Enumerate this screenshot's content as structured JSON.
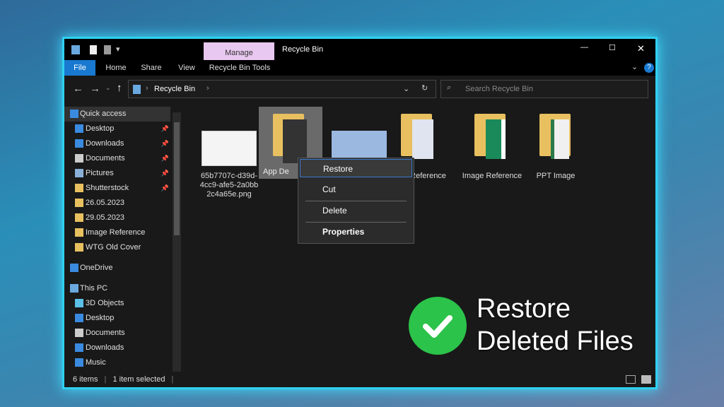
{
  "window": {
    "title": "Recycle Bin",
    "manage_tab": "Manage",
    "minimize": "—",
    "maximize": "☐",
    "close": "✕"
  },
  "ribbon": {
    "tabs": [
      "File",
      "Home",
      "Share",
      "View",
      "Recycle Bin Tools"
    ],
    "help": "?"
  },
  "address": {
    "path": "Recycle Bin",
    "search_placeholder": "Search Recycle Bin"
  },
  "sidebar": {
    "items": [
      {
        "label": "Quick access",
        "icon": "star-icon",
        "pinned": false
      },
      {
        "label": "Desktop",
        "icon": "desktop-icon",
        "pinned": true
      },
      {
        "label": "Downloads",
        "icon": "download-icon",
        "pinned": true
      },
      {
        "label": "Documents",
        "icon": "document-icon",
        "pinned": true
      },
      {
        "label": "Pictures",
        "icon": "pictures-icon",
        "pinned": true
      },
      {
        "label": "Shutterstock",
        "icon": "folder-icon",
        "pinned": true
      },
      {
        "label": "26.05.2023",
        "icon": "folder-icon",
        "pinned": false
      },
      {
        "label": "29.05.2023",
        "icon": "folder-icon",
        "pinned": false
      },
      {
        "label": "Image Reference",
        "icon": "folder-icon",
        "pinned": false
      },
      {
        "label": "WTG Old Cover",
        "icon": "folder-icon",
        "pinned": false
      },
      {
        "label": "OneDrive",
        "icon": "cloud-icon",
        "pinned": false
      },
      {
        "label": "This PC",
        "icon": "computer-icon",
        "pinned": false
      },
      {
        "label": "3D Objects",
        "icon": "cube-icon",
        "pinned": false
      },
      {
        "label": "Desktop",
        "icon": "desktop-icon",
        "pinned": false
      },
      {
        "label": "Documents",
        "icon": "document-icon",
        "pinned": false
      },
      {
        "label": "Downloads",
        "icon": "download-icon",
        "pinned": false
      },
      {
        "label": "Music",
        "icon": "music-icon",
        "pinned": false
      }
    ]
  },
  "files": [
    {
      "name": "65b7707c-d39d-4cc9-afe5-2a0bb2c4a65e.png"
    },
    {
      "name": "App De"
    },
    {
      "name": ""
    },
    {
      "name": "e Reference"
    },
    {
      "name": "Image Reference"
    },
    {
      "name": "PPT Image"
    }
  ],
  "context_menu": [
    "Restore",
    "Cut",
    "Delete",
    "Properties"
  ],
  "status": {
    "count": "6 items",
    "selected": "1 item selected"
  },
  "overlay": {
    "line1": "Restore",
    "line2": "Deleted Files"
  },
  "colors": {
    "accent": "#1979d0",
    "border_glow": "#2fd0f0",
    "check": "#2bc34a"
  }
}
